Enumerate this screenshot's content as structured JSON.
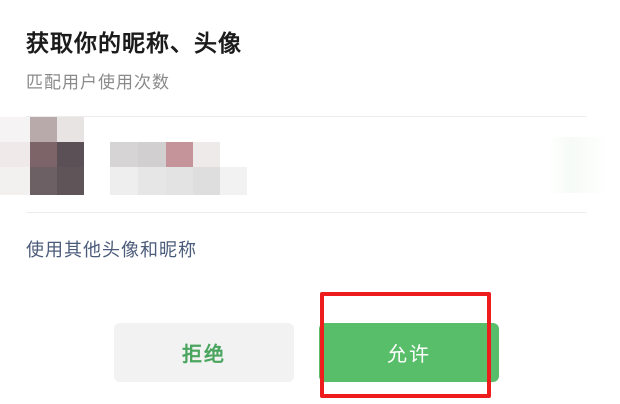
{
  "dialog": {
    "title": "获取你的昵称、头像",
    "subtitle": "匹配用户使用次数",
    "other_option": "使用其他头像和昵称"
  },
  "buttons": {
    "reject_label": "拒绝",
    "allow_label": "允许"
  },
  "colors": {
    "allow_bg": "#58be6a",
    "reject_text": "#4aa55f",
    "highlight": "#ee1c1c",
    "link": "#4b5b7a"
  }
}
